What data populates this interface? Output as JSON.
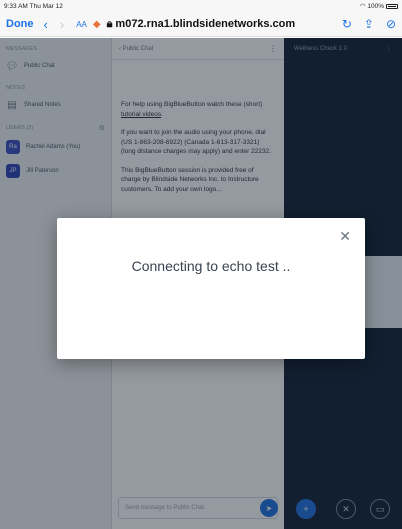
{
  "status": {
    "time": "9:33 AM",
    "date": "Thu Mar 12",
    "battery": "100%"
  },
  "browser": {
    "done_label": "Done",
    "url": "m072.rna1.blindsidenetworks.com",
    "aa_label": "AA"
  },
  "sidebar": {
    "messages_header": "MESSAGES",
    "public_chat": "Public Chat",
    "notes_header": "NOTES",
    "shared_notes": "Shared Notes",
    "users_header": "USERS (2)",
    "users": [
      {
        "initials": "Ra",
        "name": "Rachel Adams (You)",
        "color": "#3b4fc4"
      },
      {
        "initials": "JP",
        "name": "Jill Paterson",
        "color": "#2e43b8"
      }
    ]
  },
  "chat": {
    "title": "Public Chat",
    "paragraph1": "For help using BigBlueButton watch these (short)",
    "paragraph1_link": "tutorial videos",
    "paragraph2": "If you want to join the audio using your phone, dial (US 1-863-208-6922) (Canada 1-613-317-3321) (long distance charges may apply) and enter 22232.",
    "paragraph3": "This BigBlueButton session is provided free of charge by Blindside Networks Inc. to Instructure customers. To add your own logo...",
    "input_placeholder": "Send message to Public Chat"
  },
  "presentation": {
    "title": "Wellness Check 1.0"
  },
  "modal": {
    "message": "Connecting to echo test .."
  }
}
